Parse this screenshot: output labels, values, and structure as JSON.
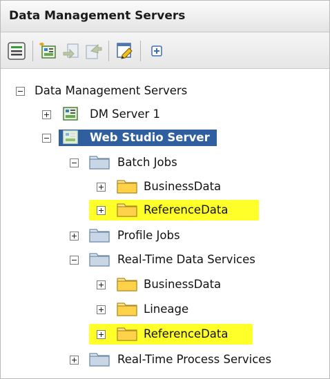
{
  "panel": {
    "title": "Data Management Servers"
  },
  "toolbar": {
    "buttons": [
      {
        "icon": "properties-icon"
      },
      {
        "icon": "new-server-icon"
      },
      {
        "icon": "import-icon"
      },
      {
        "icon": "export-icon"
      },
      {
        "icon": "edit-icon"
      },
      {
        "icon": "expand-all-icon"
      }
    ]
  },
  "tree": {
    "root": {
      "label": "Data Management Servers",
      "expanded": true
    },
    "dm_server_1": {
      "label": "DM Server 1",
      "expanded": false
    },
    "web_studio_server": {
      "label": "Web Studio Server",
      "expanded": true,
      "selected": true
    },
    "batch_jobs": {
      "label": "Batch Jobs",
      "expanded": true
    },
    "batch_business_data": {
      "label": "BusinessData",
      "expanded": false
    },
    "batch_reference_data": {
      "label": "ReferenceData",
      "expanded": false,
      "highlighted": true
    },
    "profile_jobs": {
      "label": "Profile Jobs",
      "expanded": false
    },
    "rt_data_services": {
      "label": "Real-Time Data Services",
      "expanded": true
    },
    "rt_business_data": {
      "label": "BusinessData",
      "expanded": false
    },
    "rt_lineage": {
      "label": "Lineage",
      "expanded": false
    },
    "rt_reference_data": {
      "label": "ReferenceData",
      "expanded": false,
      "highlighted": true
    },
    "rt_process_services": {
      "label": "Real-Time Process Services",
      "expanded": false
    }
  },
  "colors": {
    "selection": "#2f5f9f",
    "highlight": "#ffff2a",
    "folder_gray": "#c9d6e6",
    "folder_yellow": "#ffd24a"
  }
}
